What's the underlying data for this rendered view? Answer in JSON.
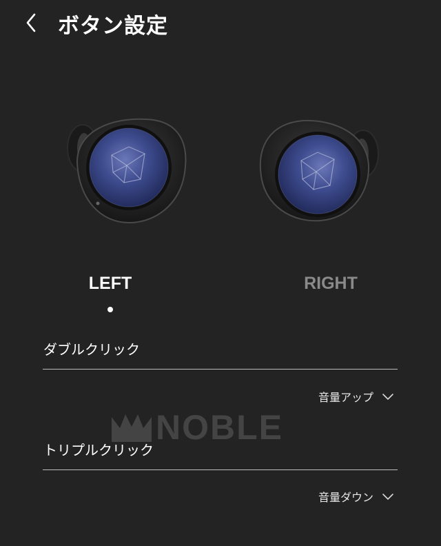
{
  "header": {
    "title": "ボタン設定",
    "back_icon": "chevron-left-icon"
  },
  "earbuds": {
    "left_image": "left-earbud-image",
    "right_image": "right-earbud-image"
  },
  "tabs": {
    "left_label": "LEFT",
    "right_label": "RIGHT",
    "selected": "LEFT"
  },
  "settings": [
    {
      "label": "ダブルクリック",
      "value": "音量アップ"
    },
    {
      "label": "トリプルクリック",
      "value": "音量ダウン"
    }
  ],
  "watermark": {
    "text": "NOBLE"
  },
  "colors": {
    "background": "#232323",
    "text_primary": "#ffffff",
    "text_inactive": "#8a8a8a",
    "divider": "#bdbdbd",
    "earbud_accent": "#3a4a8e"
  }
}
